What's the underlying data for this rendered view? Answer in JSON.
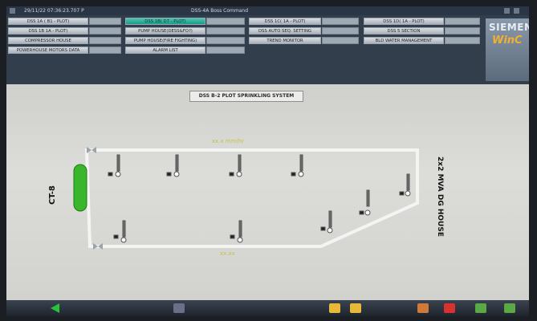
{
  "titlebar": {
    "timestamp": "29/11/22   07:36:23.707 P",
    "title": "DSS-4A Boss Command"
  },
  "menu": {
    "col1": [
      "DSS 1A ( B1 - PLOT)",
      "DSS 1B 1A - PLOT)",
      "COMPRESSOR HOUSE",
      "POWERHOUSE MOTORS DATA"
    ],
    "col2": [
      "DSS 1B( D7 - PLOT)",
      "PUMP HOUSE(DESS&FO?)",
      "PUMP HOUSE(FIRE FIGHTING)",
      "ALARM LIST"
    ],
    "col3": [
      "DSS 1C( 1A - PLOT)",
      "DSS AUTO SEQ. SETTING",
      "TREND MONITOR"
    ],
    "col4": [
      "DSS 1D( 1A - PLOT)",
      "DSS 5 SECTION",
      "BLD WATER MANAGEMENT"
    ]
  },
  "brand": {
    "line1": "SIEMEN",
    "line2": "WinC"
  },
  "main": {
    "system_title": "DSS B-2 PLOT SPRINKLING SYSTEM",
    "left_label": "CT-8",
    "right_label": "2x2 MVA DG HOUSE",
    "top_pipe_label": "xx.x mm/hr",
    "bottom_pipe_label": "xx.xx"
  },
  "colors": {
    "menu_bg": "#323e4c",
    "active_button": "#1e9a86",
    "pipe": "#f4f4f2",
    "green_tank": "#39b62b"
  }
}
